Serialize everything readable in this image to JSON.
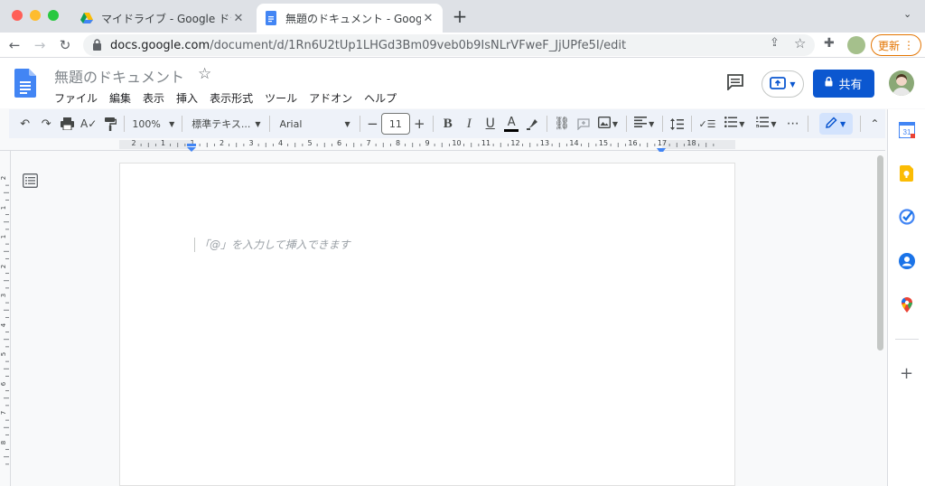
{
  "browser": {
    "tabs": [
      {
        "title": "マイドライブ - Google ドライブ",
        "icon": "google-drive-icon"
      },
      {
        "title": "無題のドキュメント - Google ドキ",
        "icon": "google-docs-icon"
      }
    ],
    "new_tab": "+",
    "tab_close": "✕",
    "url_host": "docs.google.com",
    "url_path": "/document/d/1Rn6U2tUp1LHGd3Bm09veb0b9IsNLrVFweF_JjUPfe5I/edit",
    "update_button": "更新"
  },
  "docs": {
    "title": "無題のドキュメント",
    "menu": [
      "ファイル",
      "編集",
      "表示",
      "挿入",
      "表示形式",
      "ツール",
      "アドオン",
      "ヘルプ"
    ],
    "share_label": "共有",
    "toolbar": {
      "zoom": "100%",
      "style": "標準テキス...",
      "font": "Arial",
      "font_size": "11"
    },
    "ruler_labels": [
      "2",
      "1",
      "1",
      "2",
      "3",
      "4",
      "5",
      "6",
      "7",
      "8",
      "9",
      "10",
      "11",
      "12",
      "13",
      "14",
      "15",
      "16",
      "17",
      "18"
    ],
    "vruler_labels": [
      "2",
      "1",
      "1",
      "2",
      "3",
      "4",
      "5",
      "6",
      "7",
      "8"
    ],
    "placeholder": "「@」を入力して挿入できます"
  },
  "colors": {
    "docs_blue": "#4285f4",
    "share_blue": "#0b57d0",
    "update_orange": "#e37400"
  }
}
